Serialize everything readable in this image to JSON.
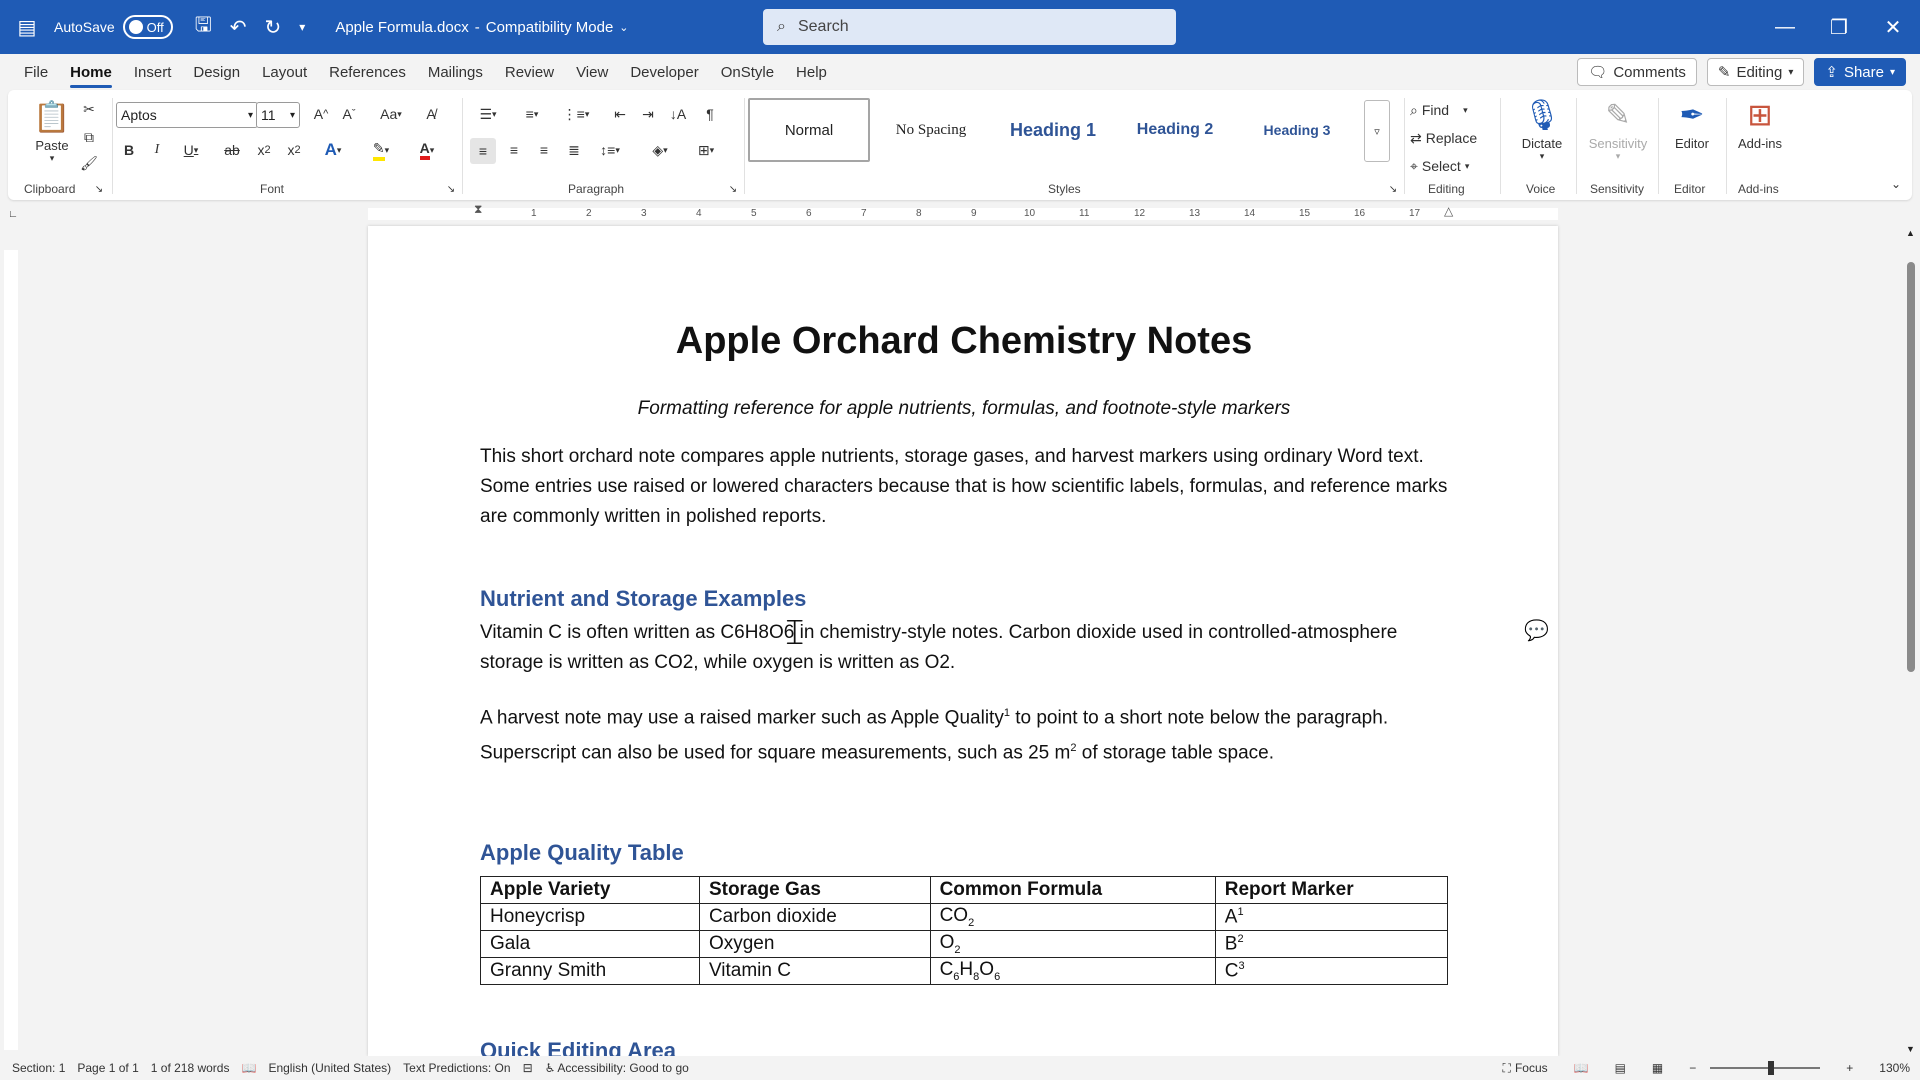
{
  "titlebar": {
    "autosave_label": "AutoSave",
    "autosave_state": "Off",
    "doc_title": "Apple Formula.docx",
    "separator": "-",
    "mode": "Compatibility Mode",
    "search_placeholder": "Search"
  },
  "menu": {
    "tabs": [
      "File",
      "Home",
      "Insert",
      "Design",
      "Layout",
      "References",
      "Mailings",
      "Review",
      "View",
      "Developer",
      "OnStyle",
      "Help"
    ],
    "active": "Home",
    "comments_label": "Comments",
    "editing_label": "Editing",
    "share_label": "Share"
  },
  "ribbon": {
    "paste_label": "Paste",
    "font_name": "Aptos",
    "font_size": "11",
    "change_case": "Aa",
    "styles": [
      "Normal",
      "No Spacing",
      "Heading 1",
      "Heading 2",
      "Heading 3"
    ],
    "find_label": "Find",
    "replace_label": "Replace",
    "select_label": "Select",
    "dictate_label": "Dictate",
    "sensitivity_label": "Sensitivity",
    "editor_label": "Editor",
    "addins_label": "Add-ins",
    "groups": {
      "clipboard": "Clipboard",
      "font": "Font",
      "paragraph": "Paragraph",
      "styles": "Styles",
      "editing": "Editing",
      "voice": "Voice",
      "sensitivity": "Sensitivity",
      "editor": "Editor",
      "addins": "Add-ins"
    }
  },
  "ruler": {
    "labels": [
      "1",
      "2",
      "3",
      "4",
      "5",
      "6",
      "7",
      "8",
      "9",
      "10",
      "11",
      "12",
      "13",
      "14",
      "15",
      "16",
      "17"
    ]
  },
  "document": {
    "title": "Apple Orchard Chemistry Notes",
    "subtitle": "Formatting reference for apple nutrients, formulas, and footnote-style markers",
    "intro": "This short orchard note compares apple nutrients, storage gases, and harvest markers using ordinary Word text. Some entries use raised or lowered characters because that is how scientific labels, formulas, and reference marks are commonly written in polished reports.",
    "h2_nutrient": "Nutrient and Storage Examples",
    "para_vitamin": "Vitamin C is often written as C6H8O6 in chemistry-style notes. Carbon dioxide used in controlled-atmosphere storage is written as CO2, while oxygen is written as O2.",
    "para_harvest_a": "A harvest note may use a raised marker such as Apple Quality",
    "para_harvest_sup1": "1",
    "para_harvest_b": " to point to a short note below the paragraph. Superscript can also be used for square measurements, such as 25 m",
    "para_harvest_sup2": "2",
    "para_harvest_c": " of storage table space.",
    "h2_table": "Apple Quality Table",
    "table": {
      "headers": [
        "Apple Variety",
        "Storage Gas",
        "Common Formula",
        "Report Marker"
      ],
      "rows": [
        {
          "variety": "Honeycrisp",
          "gas": "Carbon dioxide",
          "formula_parts": [
            "CO",
            "2"
          ],
          "marker": "A",
          "marker_sup": "1"
        },
        {
          "variety": "Gala",
          "gas": "Oxygen",
          "formula_parts": [
            "O",
            "2"
          ],
          "marker": "B",
          "marker_sup": "2"
        },
        {
          "variety": "Granny Smith",
          "gas": "Vitamin C",
          "formula_parts": [
            "C",
            "6",
            "H",
            "8",
            "O",
            "6"
          ],
          "marker": "C",
          "marker_sup": "3"
        }
      ]
    },
    "h2_quick": "Quick Editing Area"
  },
  "status": {
    "section": "Section: 1",
    "page": "Page 1 of 1",
    "words": "1 of 218 words",
    "language": "English (United States)",
    "predictions": "Text Predictions: On",
    "accessibility": "Accessibility: Good to go",
    "focus": "Focus",
    "zoom": "130%"
  }
}
